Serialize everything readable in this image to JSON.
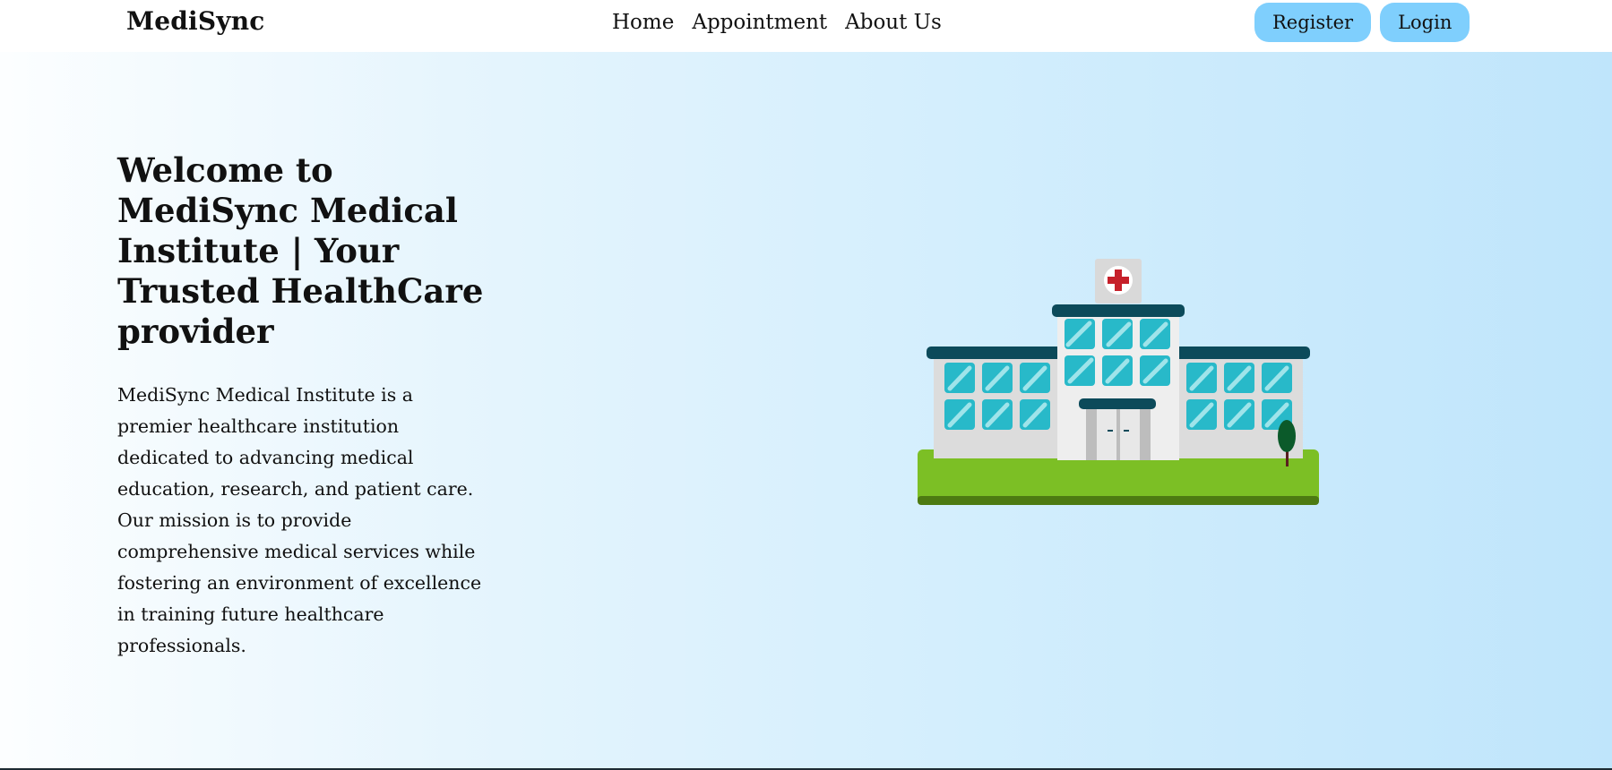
{
  "navbar": {
    "brand": "MediSync",
    "links": [
      {
        "label": "Home"
      },
      {
        "label": "Appointment"
      },
      {
        "label": "About Us"
      }
    ],
    "auth": {
      "register_label": "Register",
      "login_label": "Login"
    }
  },
  "hero": {
    "title": "Welcome to MediSync Medical Institute | Your Trusted HealthCare provider",
    "description": "MediSync Medical Institute is a premier healthcare institution dedicated to advancing medical education, research, and patient care. Our mission is to provide comprehensive medical services while fostering an environment of excellence in training future healthcare professionals.",
    "illustration": "hospital-illustration"
  },
  "colors": {
    "button_bg": "#7fcffd",
    "roof": "#0c4a5a",
    "glass": "#28b9c9",
    "grass": "#7cbf25",
    "cross": "#c6202a"
  }
}
